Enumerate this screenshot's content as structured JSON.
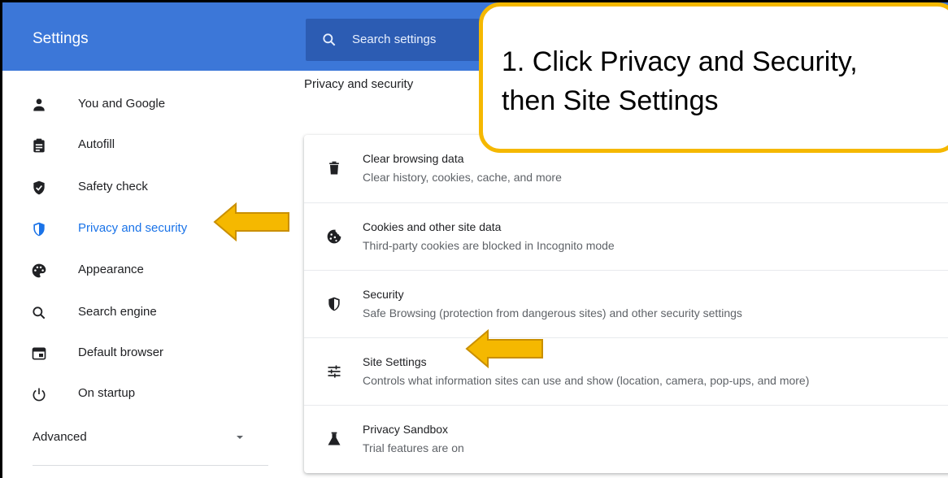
{
  "header": {
    "title": "Settings",
    "search_placeholder": "Search settings",
    "color": "#3c77d8"
  },
  "sidebar": {
    "items": [
      {
        "label": "You and Google",
        "icon": "person-icon"
      },
      {
        "label": "Autofill",
        "icon": "clipboard-icon"
      },
      {
        "label": "Safety check",
        "icon": "shield-check-icon"
      },
      {
        "label": "Privacy and security",
        "icon": "shield-icon",
        "active": true
      },
      {
        "label": "Appearance",
        "icon": "palette-icon"
      },
      {
        "label": "Search engine",
        "icon": "search-icon"
      },
      {
        "label": "Default browser",
        "icon": "browser-icon"
      },
      {
        "label": "On startup",
        "icon": "power-icon"
      }
    ],
    "advanced_label": "Advanced",
    "active_color": "#1a73e8"
  },
  "main": {
    "section_title": "Privacy and security",
    "rows": [
      {
        "title": "Clear browsing data",
        "subtitle": "Clear history, cookies, cache, and more",
        "icon": "trash-icon"
      },
      {
        "title": "Cookies and other site data",
        "subtitle": "Third-party cookies are blocked in Incognito mode",
        "icon": "cookie-icon"
      },
      {
        "title": "Security",
        "subtitle": "Safe Browsing (protection from dangerous sites) and other security settings",
        "icon": "shield-outline-icon"
      },
      {
        "title": "Site Settings",
        "subtitle": "Controls what information sites can use and show (location, camera, pop-ups, and more)",
        "icon": "tune-icon"
      },
      {
        "title": "Privacy Sandbox",
        "subtitle": "Trial features are on",
        "icon": "flask-icon"
      }
    ]
  },
  "callout": {
    "line1": "1. Click Privacy and Security,",
    "line2": "then Site Settings",
    "border_color": "#f5b800"
  },
  "annotation_arrow_color": "#f5b800"
}
